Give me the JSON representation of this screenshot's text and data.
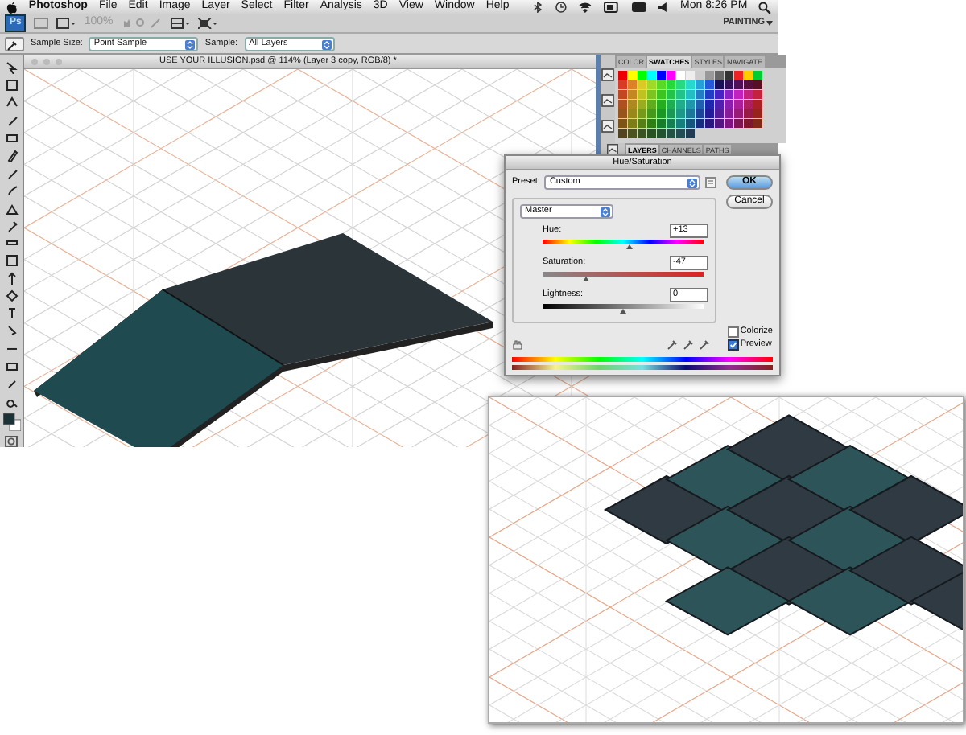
{
  "menubar": {
    "app": "Photoshop",
    "menus": [
      "File",
      "Edit",
      "Image",
      "Layer",
      "Select",
      "Filter",
      "Analysis",
      "3D",
      "View",
      "Window",
      "Help"
    ],
    "clock": "Mon 8:26 PM"
  },
  "app_bar": {
    "logo": "Ps",
    "zoom": "100%",
    "workspace": "PAINTING"
  },
  "options_bar": {
    "sample_size_label": "Sample Size:",
    "sample_size": "Point Sample",
    "sample_label": "Sample:",
    "sample": "All Layers"
  },
  "document": {
    "title": "USE YOUR ILLUSION.psd @ 114% (Layer 3 copy, RGB/8) *"
  },
  "swatches_panel": {
    "tabs": [
      {
        "label": "COLOR",
        "selected": false
      },
      {
        "label": "SWATCHES",
        "selected": true
      },
      {
        "label": "STYLES",
        "selected": false
      },
      {
        "label": "NAVIGATE",
        "selected": false
      }
    ]
  },
  "layers_panel": {
    "tabs": [
      {
        "label": "LAYERS",
        "selected": true
      },
      {
        "label": "CHANNELS",
        "selected": false
      },
      {
        "label": "PATHS",
        "selected": false
      }
    ]
  },
  "dialog": {
    "title": "Hue/Saturation",
    "preset_label": "Preset:",
    "preset": "Custom",
    "buttons": [
      {
        "label": "OK",
        "default": true
      },
      {
        "label": "Cancel",
        "default": false
      }
    ],
    "channel": "Master",
    "sliders": [
      {
        "kind": "hue",
        "label": "Hue:",
        "value": "+13",
        "level": 0.54
      },
      {
        "kind": "saturation",
        "label": "Saturation:",
        "value": "-47",
        "level": 0.27
      },
      {
        "kind": "lightness",
        "label": "Lightness:",
        "value": "0",
        "level": 0.5
      }
    ],
    "checkboxes": [
      {
        "label": "Colorize",
        "checked": false
      },
      {
        "label": "Preview",
        "checked": true
      }
    ]
  }
}
